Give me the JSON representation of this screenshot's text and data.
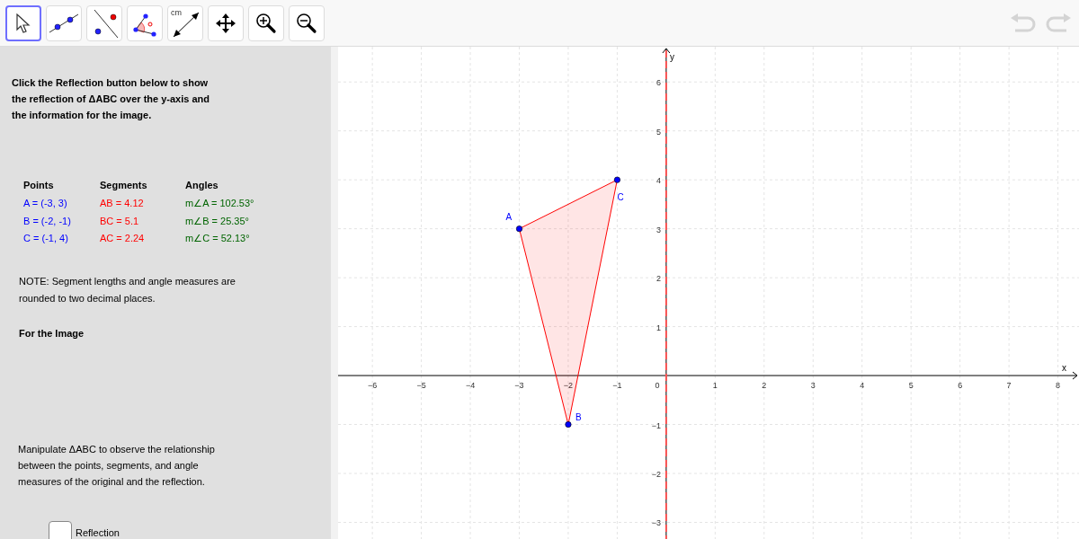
{
  "toolbar": {
    "tools": [
      {
        "kind": "move",
        "selected": true
      },
      {
        "kind": "line",
        "selected": false
      },
      {
        "kind": "reflect",
        "selected": false
      },
      {
        "kind": "angle",
        "selected": false
      },
      {
        "kind": "distance",
        "label": "cm",
        "selected": false
      },
      {
        "kind": "pan",
        "selected": false
      },
      {
        "kind": "zoom-in",
        "selected": false
      },
      {
        "kind": "zoom-out",
        "selected": false
      }
    ],
    "undo": {
      "disabled": true
    },
    "redo": {
      "disabled": true
    }
  },
  "panel": {
    "intro": [
      "Click the Reflection button below to show",
      "the reflection of ΔABC over the y-axis and",
      "the information for the image."
    ],
    "table": {
      "columns": [
        {
          "heading": "Points",
          "color": "#0000ff",
          "cells": [
            "A = (-3, 3)",
            "B = (-2, -1)",
            "C = (-1, 4)"
          ]
        },
        {
          "heading": "Segments",
          "color": "#ff0000",
          "cells": [
            "AB = 4.12",
            "BC = 5.1",
            "AC = 2.24"
          ]
        },
        {
          "heading": "Angles",
          "color": "#006400",
          "cells": [
            "m∠A = 102.53°",
            "m∠B = 25.35°",
            "m∠C = 52.13°"
          ]
        }
      ]
    },
    "note": [
      "NOTE: Segment lengths and angle measures are",
      "rounded to two decimal places."
    ],
    "image_heading": "For the Image",
    "instructions": [
      "Manipulate ΔABC to observe the relationship",
      "between the points, segments, and angle",
      "measures of the original and the reflection."
    ],
    "checkbox": {
      "label": "Reflection",
      "checked": false
    }
  },
  "graph": {
    "chart_data": {
      "type": "scatter",
      "xlabel": "x",
      "ylabel": "y",
      "xlim": [
        -6.7,
        8.43
      ],
      "ylim": [
        -3.34,
        6.72
      ],
      "xticks": [
        {
          "value": -6,
          "label": "−6"
        },
        {
          "value": -5,
          "label": "−5"
        },
        {
          "value": -4,
          "label": "−4"
        },
        {
          "value": -3,
          "label": "−3"
        },
        {
          "value": -2,
          "label": "−2"
        },
        {
          "value": -1,
          "label": "−1"
        },
        {
          "value": 1,
          "label": "1"
        },
        {
          "value": 2,
          "label": "2"
        },
        {
          "value": 3,
          "label": "3"
        },
        {
          "value": 4,
          "label": "4"
        },
        {
          "value": 5,
          "label": "5"
        },
        {
          "value": 6,
          "label": "6"
        },
        {
          "value": 7,
          "label": "7"
        },
        {
          "value": 8,
          "label": "8"
        }
      ],
      "yticks": [
        {
          "value": -3,
          "label": "−3"
        },
        {
          "value": -2,
          "label": "−2"
        },
        {
          "value": -1,
          "label": "−1"
        },
        {
          "value": 1,
          "label": "1"
        },
        {
          "value": 2,
          "label": "2"
        },
        {
          "value": 3,
          "label": "3"
        },
        {
          "value": 4,
          "label": "4"
        },
        {
          "value": 5,
          "label": "5"
        },
        {
          "value": 6,
          "label": "6"
        }
      ],
      "grid": true,
      "ref_lines": [
        {
          "axis": "x",
          "value": 0,
          "color": "#ff5555"
        }
      ],
      "x": [
        -3,
        -2,
        -1
      ],
      "series": [
        {
          "color": "#0000ff",
          "values": [
            3,
            -1,
            4
          ]
        }
      ],
      "annotations": [
        {
          "text": "A",
          "x": -3,
          "y": 3
        },
        {
          "text": "B",
          "x": -2,
          "y": -1
        },
        {
          "text": "C",
          "x": -1,
          "y": 4
        }
      ]
    },
    "origin_label": "0"
  }
}
